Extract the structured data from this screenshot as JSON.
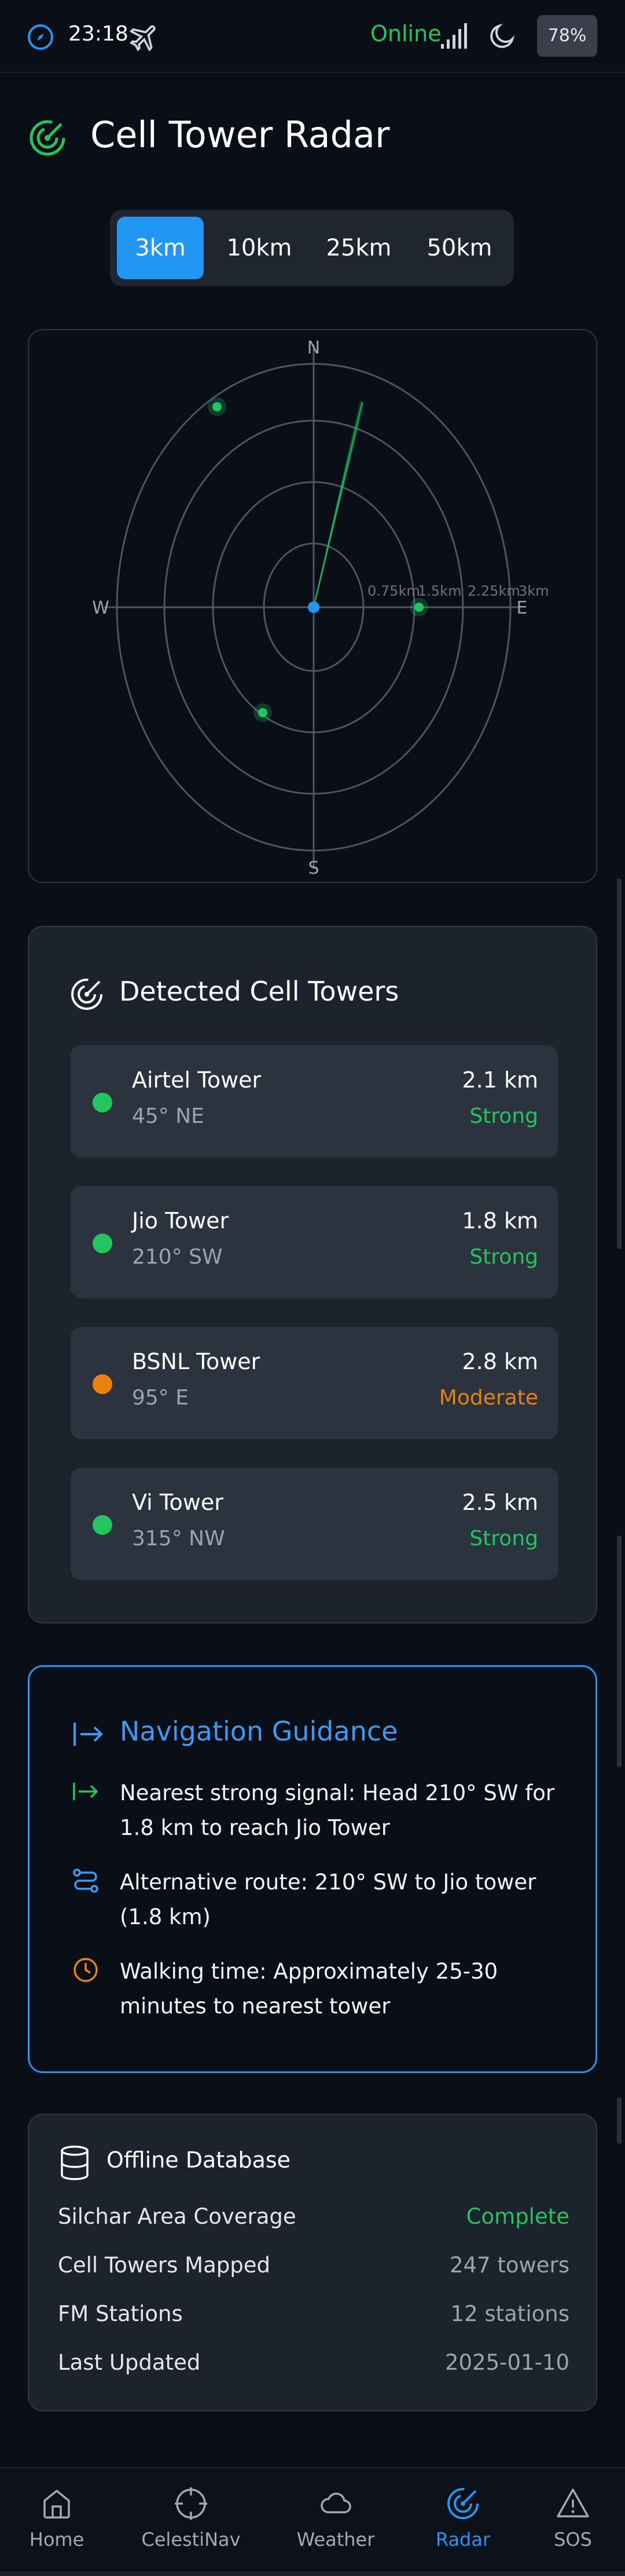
{
  "status_bar": {
    "time": "23:18",
    "network_status": "Online",
    "battery": "78%",
    "icons": [
      "compass-icon",
      "airplane-icon",
      "signal-icon",
      "moon-icon"
    ]
  },
  "header": {
    "title": "Cell Tower Radar",
    "icon": "radar-icon"
  },
  "range_selector": {
    "options": [
      "3km",
      "10km",
      "25km",
      "50km"
    ],
    "selected": "3km"
  },
  "radar": {
    "directions": {
      "n": "N",
      "e": "E",
      "s": "S",
      "w": "W"
    },
    "ring_labels": [
      "0.75km",
      "1.5km",
      "2.25km",
      "3km"
    ],
    "towers_shown": 3
  },
  "towers": {
    "heading": "Detected Cell Towers",
    "items": [
      {
        "name": "Airtel Tower",
        "bearing": "45° NE",
        "distance": "2.1 km",
        "strength": "Strong",
        "status_color": "#22c55e"
      },
      {
        "name": "Jio Tower",
        "bearing": "210° SW",
        "distance": "1.8 km",
        "strength": "Strong",
        "status_color": "#22c55e"
      },
      {
        "name": "BSNL Tower",
        "bearing": "95° E",
        "distance": "2.8 km",
        "strength": "Moderate",
        "status_color": "#e8830c"
      },
      {
        "name": "Vi Tower",
        "bearing": "315° NW",
        "distance": "2.5 km",
        "strength": "Strong",
        "status_color": "#22c55e"
      }
    ]
  },
  "navigation": {
    "heading": "Navigation Guidance",
    "items": [
      {
        "icon": "arrow-right-icon",
        "text": "Nearest strong signal: Head 210° SW for 1.8 km to reach Jio Tower"
      },
      {
        "icon": "route-icon",
        "text": "Alternative route: 210° SW to Jio tower (1.8 km)"
      },
      {
        "icon": "clock-icon",
        "text": "Walking time: Approximately 25-30 minutes to nearest tower"
      }
    ]
  },
  "offline_db": {
    "heading": "Offline Database",
    "rows": [
      {
        "label": "Silchar Area Coverage",
        "value": "Complete",
        "color": "#22c55e"
      },
      {
        "label": "Cell Towers Mapped",
        "value": "247 towers"
      },
      {
        "label": "FM Stations",
        "value": "12 stations"
      },
      {
        "label": "Last Updated",
        "value": "2025-01-10"
      }
    ]
  },
  "bottom_nav": {
    "items": [
      {
        "label": "Home",
        "icon": "home-icon"
      },
      {
        "label": "CelestiNav",
        "icon": "crosshair-icon"
      },
      {
        "label": "Weather",
        "icon": "cloud-icon"
      },
      {
        "label": "Radar",
        "icon": "radar-icon"
      },
      {
        "label": "SOS",
        "icon": "warning-icon"
      }
    ],
    "active": "Radar"
  },
  "colors": {
    "accent": "#2196f3",
    "strong": "#22c55e",
    "moderate": "#e8830c",
    "background": "#0a0e17",
    "card": "#1c232d"
  }
}
